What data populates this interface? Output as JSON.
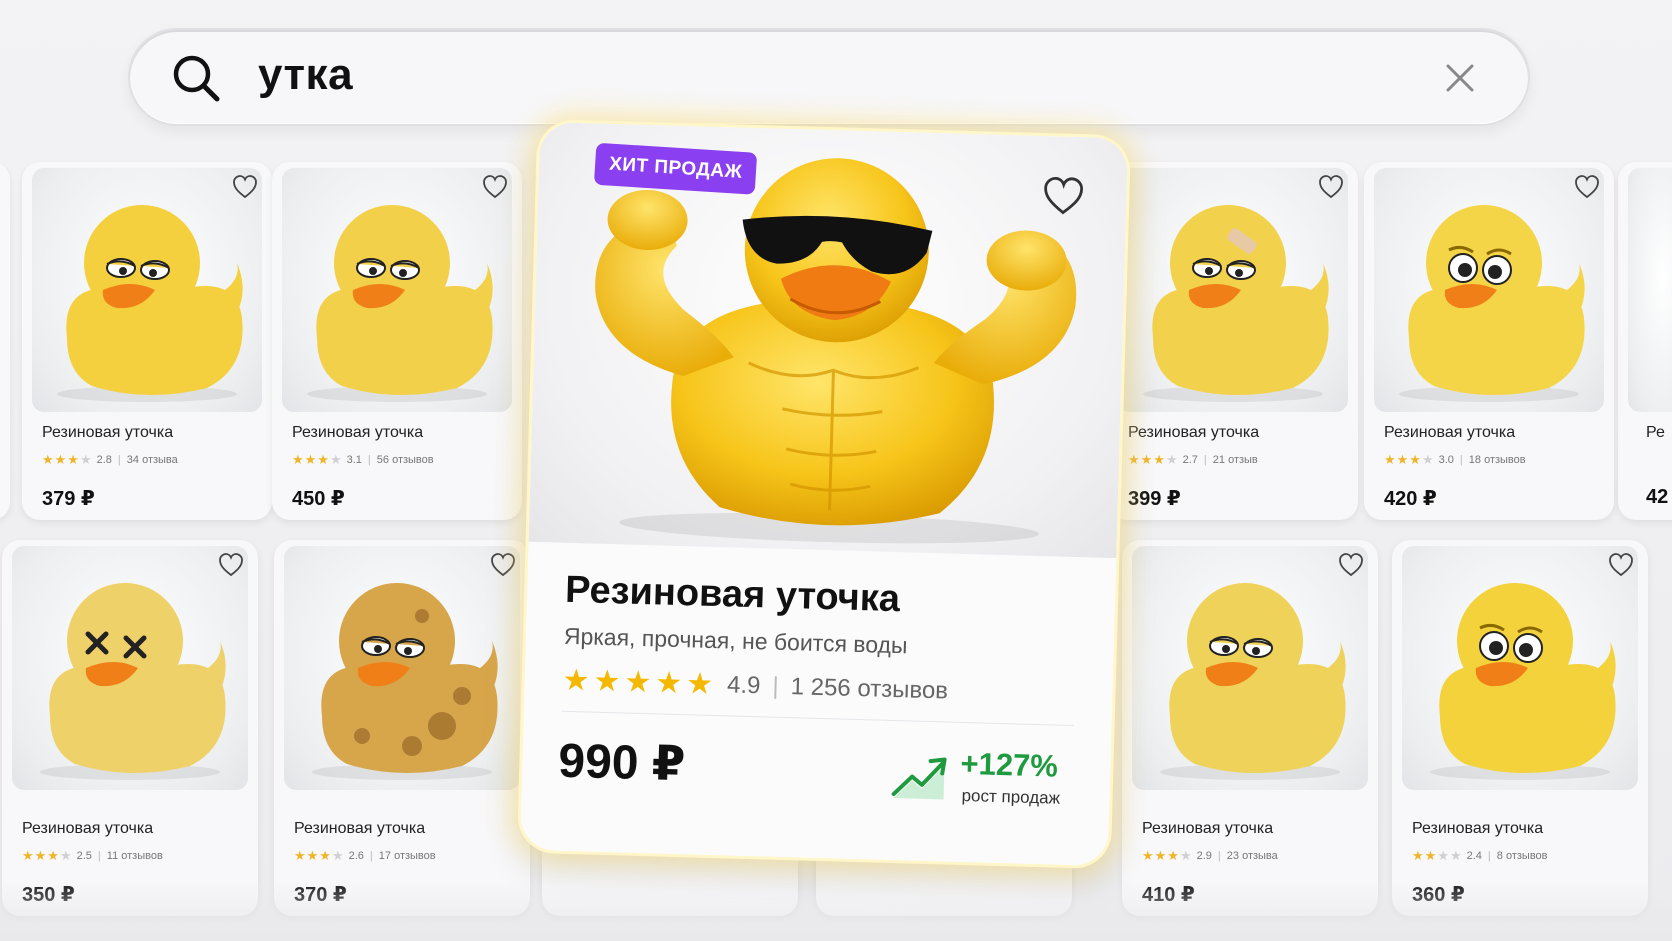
{
  "search": {
    "query": "утка"
  },
  "featured": {
    "badge": "ХИТ ПРОДАЖ",
    "name": "Резиновая уточка",
    "description": "Яркая, прочная, не боится воды",
    "stars": 5,
    "rating": "4.9",
    "reviews": "1 256 отзывов",
    "price": "990 ₽",
    "growth_value": "+127%",
    "growth_label": "рост продаж",
    "colors": {
      "badge": "#8a3ff0",
      "growth": "#1f9a3f",
      "star": "#f5b800"
    }
  },
  "products": [
    {
      "name": "Резиновая уточка",
      "rating": "2.8",
      "reviews": "34 отзыва",
      "price": "379 ₽",
      "stars_on": 3,
      "mood": "sleepy",
      "color": "#f4d03f"
    },
    {
      "name": "Резиновая уточка",
      "rating": "3.1",
      "reviews": "56 отзывов",
      "price": "450 ₽",
      "stars_on": 3,
      "mood": "sleepy",
      "color": "#f2d04a"
    },
    {
      "name": "Резиновая уточка",
      "rating": "2.7",
      "reviews": "21 отзыв",
      "price": "399 ₽",
      "stars_on": 3,
      "mood": "bandaged",
      "color": "#f2d24c"
    },
    {
      "name": "Резиновая уточка",
      "rating": "3.0",
      "reviews": "18 отзывов",
      "price": "420 ₽",
      "stars_on": 3,
      "mood": "worried",
      "color": "#f5d548"
    },
    {
      "name": "Резиновая уточка",
      "rating": "2.5",
      "reviews": "11 отзывов",
      "price": "350 ₽",
      "stars_on": 3,
      "mood": "dead",
      "color": "#efd16a"
    },
    {
      "name": "Резиновая уточка",
      "rating": "2.6",
      "reviews": "17 отзывов",
      "price": "370 ₽",
      "stars_on": 3,
      "mood": "dirty",
      "color": "#d7a54a"
    },
    {
      "name": "Резиновая уточка",
      "rating": "2.9",
      "reviews": "23 отзыва",
      "price": "410 ₽",
      "stars_on": 3,
      "mood": "sleepy",
      "color": "#efd25a"
    },
    {
      "name": "Резиновая уточка",
      "rating": "2.4",
      "reviews": "8 отзывов",
      "price": "360 ₽",
      "stars_on": 2,
      "mood": "worried",
      "color": "#f4d23c"
    }
  ],
  "edge_cards": {
    "right_name": "Ре",
    "right_price": "42"
  },
  "icons": {
    "search": "search-icon",
    "clear": "close-icon",
    "favorite": "heart-icon",
    "growth": "trend-up-icon"
  }
}
